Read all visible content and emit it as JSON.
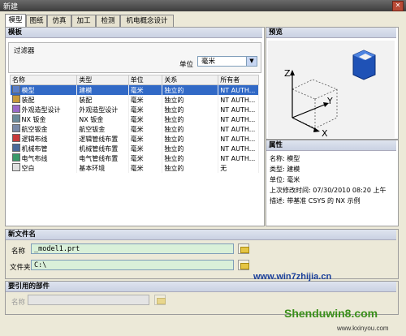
{
  "window": {
    "title": "新建",
    "close_glyph": "✕"
  },
  "tabs": [
    "模型",
    "图纸",
    "仿真",
    "加工",
    "检测",
    "机电概念设计"
  ],
  "template_section": {
    "title": "模板",
    "filter_title": "过滤器",
    "unit_label": "单位",
    "unit_value": "毫米",
    "columns": [
      "名称",
      "类型",
      "单位",
      "关系",
      "所有者"
    ],
    "rows": [
      {
        "name": "模型",
        "type": "建模",
        "unit": "毫米",
        "rel": "独立的",
        "owner": "NT AUTH...",
        "icon": "model-icon",
        "selected": true
      },
      {
        "name": "装配",
        "type": "装配",
        "unit": "毫米",
        "rel": "独立的",
        "owner": "NT AUTH...",
        "icon": "assembly-icon",
        "selected": false
      },
      {
        "name": "外观造型设计",
        "type": "外观造型设计",
        "unit": "毫米",
        "rel": "独立的",
        "owner": "NT AUTH...",
        "icon": "shape-studio-icon",
        "selected": false
      },
      {
        "name": "NX 钣金",
        "type": "NX 钣金",
        "unit": "毫米",
        "rel": "独立的",
        "owner": "NT AUTH...",
        "icon": "sheetmetal-icon",
        "selected": false
      },
      {
        "name": "航空钣金",
        "type": "航空钣金",
        "unit": "毫米",
        "rel": "独立的",
        "owner": "NT AUTH...",
        "icon": "aero-sheetmetal-icon",
        "selected": false
      },
      {
        "name": "逻辑布线",
        "type": "逻辑管线布置",
        "unit": "毫米",
        "rel": "独立的",
        "owner": "NT AUTH...",
        "icon": "logical-routing-icon",
        "selected": false
      },
      {
        "name": "机械布管",
        "type": "机械管线布置",
        "unit": "毫米",
        "rel": "独立的",
        "owner": "NT AUTH...",
        "icon": "mech-routing-icon",
        "selected": false
      },
      {
        "name": "电气布线",
        "type": "电气管线布置",
        "unit": "毫米",
        "rel": "独立的",
        "owner": "NT AUTH...",
        "icon": "elec-routing-icon",
        "selected": false
      },
      {
        "name": "空白",
        "type": "基本环境",
        "unit": "毫米",
        "rel": "独立的",
        "owner": "无",
        "icon": "blank-icon",
        "selected": false
      }
    ]
  },
  "preview": {
    "title": "预览",
    "axes": [
      "Z",
      "Y",
      "X"
    ]
  },
  "properties": {
    "title": "属性",
    "lines": [
      "名称: 模型",
      "类型: 建模",
      "单位: 毫米",
      "上次修改时间: 07/30/2010 08:20 上午",
      "描述: 带基准 CSYS 的 NX 示例"
    ]
  },
  "new_file": {
    "title": "新文件名",
    "name_label": "名称",
    "name_value": "_model1.prt",
    "folder_label": "文件夹",
    "folder_value": "C:\\"
  },
  "ref_part": {
    "title": "要引用的部件",
    "name_label": "名称"
  },
  "watermark": {
    "top_text": "www.win7zhijia.cn",
    "bottom_text": "Shenduwin8.com",
    "bottom_small": "www.kxinyou.com"
  },
  "colors": {
    "selection": "#3169c6",
    "field_bg": "#d9f0d9",
    "section_header": "#c9d1e2"
  }
}
